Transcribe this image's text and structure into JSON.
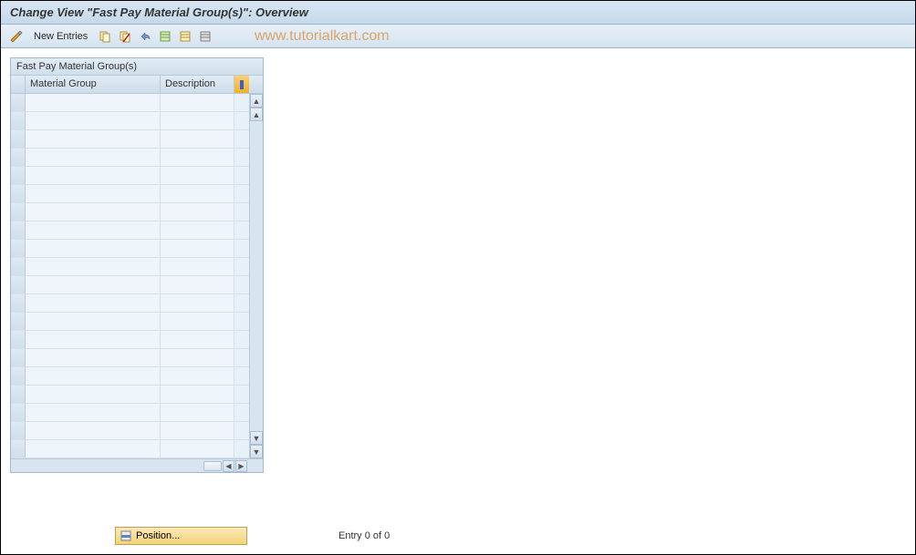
{
  "title": "Change View \"Fast Pay Material Group(s)\": Overview",
  "toolbar": {
    "new_entries_label": "New Entries"
  },
  "watermark": "www.tutorialkart.com",
  "panel": {
    "title": "Fast Pay Material Group(s)",
    "columns": {
      "material": "Material Group",
      "description": "Description"
    },
    "rows": [
      {
        "material": "",
        "description": ""
      },
      {
        "material": "",
        "description": ""
      },
      {
        "material": "",
        "description": ""
      },
      {
        "material": "",
        "description": ""
      },
      {
        "material": "",
        "description": ""
      },
      {
        "material": "",
        "description": ""
      },
      {
        "material": "",
        "description": ""
      },
      {
        "material": "",
        "description": ""
      },
      {
        "material": "",
        "description": ""
      },
      {
        "material": "",
        "description": ""
      },
      {
        "material": "",
        "description": ""
      },
      {
        "material": "",
        "description": ""
      },
      {
        "material": "",
        "description": ""
      },
      {
        "material": "",
        "description": ""
      },
      {
        "material": "",
        "description": ""
      },
      {
        "material": "",
        "description": ""
      },
      {
        "material": "",
        "description": ""
      },
      {
        "material": "",
        "description": ""
      },
      {
        "material": "",
        "description": ""
      },
      {
        "material": "",
        "description": ""
      }
    ]
  },
  "footer": {
    "position_label": "Position...",
    "entry_status": "Entry 0 of 0"
  }
}
